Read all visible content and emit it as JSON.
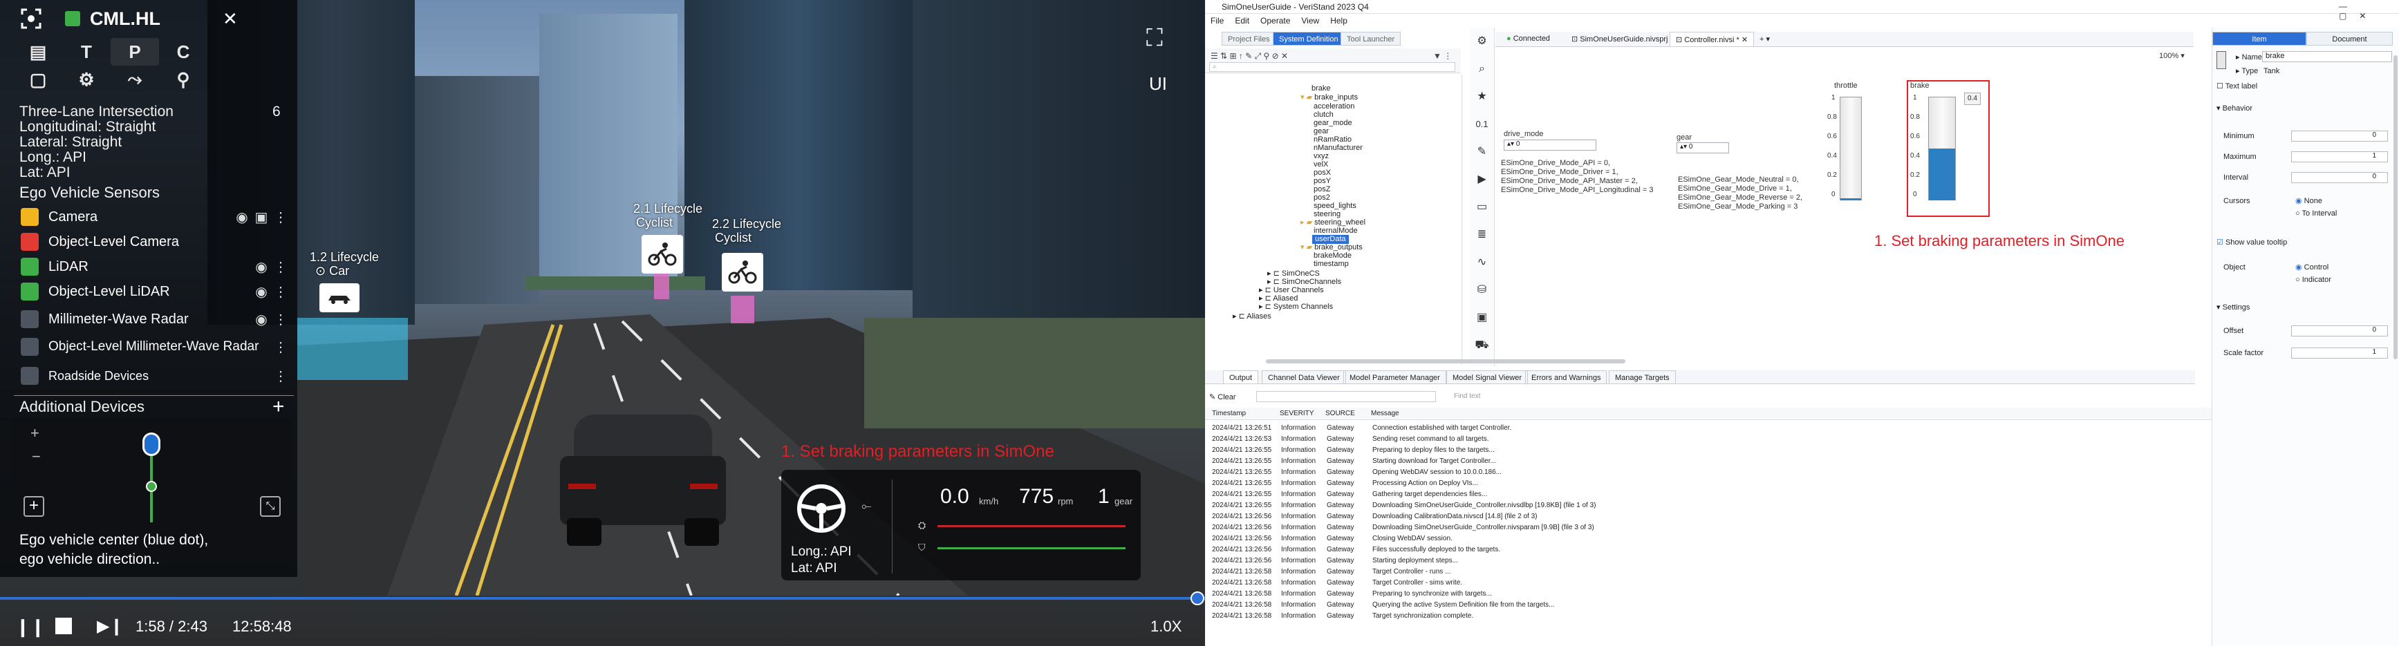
{
  "sim": {
    "toolbar": {
      "logo": "CML.HL",
      "close": "✕",
      "tools": [
        "T",
        "P",
        "C"
      ]
    },
    "scenario": {
      "name": "Three-Lane Intersection",
      "count": "6",
      "lines": [
        "Longitudinal:  Straight",
        "Lateral:     Straight",
        "Long.:   API",
        "Lat:     API"
      ]
    },
    "section_sensors": "Ego Vehicle Sensors",
    "sensors": [
      {
        "label": "Camera",
        "color": "#f2b51f"
      },
      {
        "label": "Object-Level Camera",
        "color": "#e23b34"
      },
      {
        "label": "LiDAR",
        "color": "#3fae49"
      },
      {
        "label": "Object-Level LiDAR",
        "color": "#3fae49"
      },
      {
        "label": "Millimeter-Wave Radar",
        "color": "#4c5560"
      },
      {
        "label": "Object-Level Millimeter-Wave Radar",
        "color": "#4c5560"
      },
      {
        "label": "Roadside Devices",
        "color": "#4c5560"
      }
    ],
    "section_devices": "Additional Devices",
    "hint": "Ego vehicle center (blue dot), ego vehicle direction..",
    "right_controls": {
      "fullscreen": "⛶",
      "ui": "UI"
    },
    "lifecycles": [
      {
        "title": "1.2 Lifecycle",
        "sub": "Car"
      },
      {
        "title": "2.1 Lifecycle",
        "sub": "Cyclist"
      },
      {
        "title": "2.2 Lifecycle",
        "sub": "Cyclist"
      }
    ],
    "annotation": "1. Set braking parameters in SimOne",
    "dashboard": {
      "speed": "0.0",
      "speed_unit": "km/h",
      "rpm": "775",
      "rpm_unit": "rpm",
      "gear": "1",
      "gear_unit": "gear",
      "long": "Long.:  API",
      "lat": "Lat:     API",
      "throttle_level": 0,
      "brake_level": 0
    },
    "playback": {
      "time": "1:58 / 2:43",
      "clock": "12:58:48",
      "speed": "1.0X",
      "progress": 0.995
    }
  },
  "vs": {
    "title": "SimOneUserGuide - VeriStand 2023 Q4",
    "menu": [
      "File",
      "Edit",
      "Operate",
      "View",
      "Help"
    ],
    "top_tabs": [
      "Project Files",
      "System Definition",
      "Tool Launcher"
    ],
    "connection": "Connected",
    "doc_tabs": [
      "SimOneUserGuide.nivsprj",
      "Controller.nivsi *"
    ],
    "tree": [
      "brake",
      "brake_inputs",
      "acceleration",
      "clutch",
      "gear_mode",
      "gear",
      "nRamRatio",
      "nManufacturer",
      "vxyz",
      "velX",
      "posX",
      "posY",
      "posZ",
      "pos2",
      "speed_lights",
      "steering",
      "steering_wheel",
      "internalMode",
      "userData",
      "brake_outputs",
      "brakeMode",
      "timestamp",
      "SimOneCS",
      "SimOneChannels",
      "User Channels",
      "Aliased",
      "System Channels",
      "Aliases"
    ],
    "tree_selected": "userData",
    "zoom": "100%",
    "drive_mode": {
      "label": "drive_mode",
      "value": "0",
      "enums": [
        "ESimOne_Drive_Mode_API = 0,",
        "ESimOne_Drive_Mode_Driver = 1,",
        "ESimOne_Drive_Mode_API_Master = 2,",
        "ESimOne_Drive_Mode_API_Longitudinal = 3"
      ]
    },
    "gear": {
      "label": "gear",
      "value": "0",
      "enums": [
        "ESimOne_Gear_Mode_Neutral = 0,",
        "ESimOne_Gear_Mode_Drive = 1,",
        "ESimOne_Gear_Mode_Reverse = 2,",
        "ESimOne_Gear_Mode_Parking = 3"
      ]
    },
    "throttle": {
      "label": "throttle",
      "ticks": [
        "1",
        "0.8",
        "0.6",
        "0.4",
        "0.2",
        "0"
      ],
      "level": 0.02
    },
    "brake": {
      "label": "brake",
      "ticks": [
        "1",
        "0.8",
        "0.6",
        "0.4",
        "0.2",
        "0"
      ],
      "level": 0.5,
      "value": "0.4"
    },
    "annotation": "1. Set braking parameters in SimOne",
    "bottom_tabs": [
      "Output",
      "Channel Data Viewer",
      "Model Parameter Manager",
      "Model Signal Viewer",
      "Errors and Warnings",
      "Manage Targets"
    ],
    "clear": "Clear",
    "find": "Find text",
    "log_headers": [
      "Timestamp",
      "SEVERITY",
      "SOURCE",
      "Message"
    ],
    "logs": [
      [
        "2024/4/21 13:26:51",
        "Information",
        "Gateway",
        "Connection established with target Controller."
      ],
      [
        "2024/4/21 13:26:53",
        "Information",
        "Gateway",
        "Sending reset command to all targets."
      ],
      [
        "2024/4/21 13:26:55",
        "Information",
        "Gateway",
        "Preparing to deploy files to the targets..."
      ],
      [
        "2024/4/21 13:26:55",
        "Information",
        "Gateway",
        "Starting download for Target Controller..."
      ],
      [
        "2024/4/21 13:26:55",
        "Information",
        "Gateway",
        "Opening WebDAV session to 10.0.0.186..."
      ],
      [
        "2024/4/21 13:26:55",
        "Information",
        "Gateway",
        "Processing Action on Deploy VIs..."
      ],
      [
        "2024/4/21 13:26:55",
        "Information",
        "Gateway",
        "Gathering target dependencies files..."
      ],
      [
        "2024/4/21 13:26:55",
        "Information",
        "Gateway",
        "Downloading SimOneUserGuide_Controller.nivsdlbp [19.8KB] (file 1 of 3)"
      ],
      [
        "2024/4/21 13:26:56",
        "Information",
        "Gateway",
        "Downloading CalibrationData.nivscd [14.8] (file 2 of 3)"
      ],
      [
        "2024/4/21 13:26:56",
        "Information",
        "Gateway",
        "Downloading SimOneUserGuide_Controller.nivsparam [9.9B] (file 3 of 3)"
      ],
      [
        "2024/4/21 13:26:56",
        "Information",
        "Gateway",
        "Closing WebDAV session."
      ],
      [
        "2024/4/21 13:26:56",
        "Information",
        "Gateway",
        "Files successfully deployed to the targets."
      ],
      [
        "2024/4/21 13:26:56",
        "Information",
        "Gateway",
        "Starting deployment steps..."
      ],
      [
        "2024/4/21 13:26:58",
        "Information",
        "Gateway",
        "Target Controller - runs ..."
      ],
      [
        "2024/4/21 13:26:58",
        "Information",
        "Gateway",
        "Target Controller - sims write."
      ],
      [
        "2024/4/21 13:26:58",
        "Information",
        "Gateway",
        "Preparing to synchronize with targets..."
      ],
      [
        "2024/4/21 13:26:58",
        "Information",
        "Gateway",
        "Querying the active System Definition file from the targets..."
      ],
      [
        "2024/4/21 13:26:58",
        "Information",
        "Gateway",
        "Target synchronization complete."
      ]
    ],
    "right_tabs": [
      "Item",
      "Document"
    ],
    "props": {
      "name_label": "Name",
      "name_value": "brake",
      "type_label": "Type",
      "type_value": "Tank",
      "textlabel": "Text label",
      "behavior": "Behavior",
      "minimum": "Minimum",
      "maximum": "Maximum",
      "interval": "Interval",
      "cursors": "Cursors",
      "cursors_opts": [
        "None",
        "To Interval"
      ],
      "show_tooltip": "Show value tooltip",
      "object": "Object",
      "object_opts": [
        "Control",
        "Indicator"
      ],
      "settings": "Settings",
      "offset": "Offset",
      "scale": "Scale factor",
      "min_val": "0",
      "max_val": "1",
      "int_val": "0",
      "off_val": "0",
      "scale_val": "1"
    }
  }
}
